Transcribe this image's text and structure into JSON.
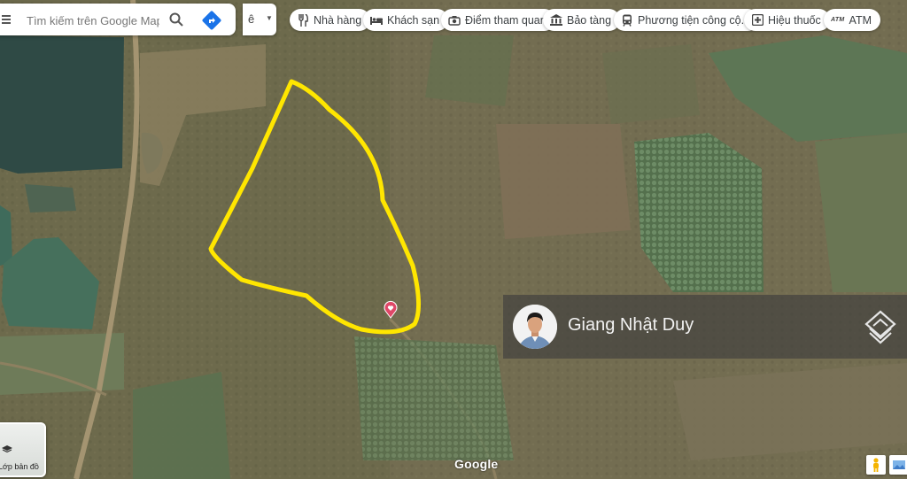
{
  "search": {
    "placeholder": "Tìm kiếm trên Google Maps"
  },
  "language": {
    "label": "ê"
  },
  "chips": [
    {
      "icon": "restaurant-icon",
      "label": "Nhà hàng"
    },
    {
      "icon": "hotel-icon",
      "label": "Khách sạn"
    },
    {
      "icon": "camera-icon",
      "label": "Điểm tham quan"
    },
    {
      "icon": "museum-icon",
      "label": "Bảo tàng"
    },
    {
      "icon": "transit-icon",
      "label": "Phương tiện công cộ..."
    },
    {
      "icon": "pharmacy-icon",
      "label": "Hiệu thuốc"
    },
    {
      "icon": "atm-icon",
      "label": "ATM",
      "icon_text": "ATM"
    }
  ],
  "layers": {
    "label": "Lớp bản đồ"
  },
  "attribution": {
    "logo": "Google"
  },
  "overlay": {
    "name": "Giang Nhật Duy"
  },
  "colors": {
    "boundary": "#ffe600",
    "pin": "#e04868"
  }
}
